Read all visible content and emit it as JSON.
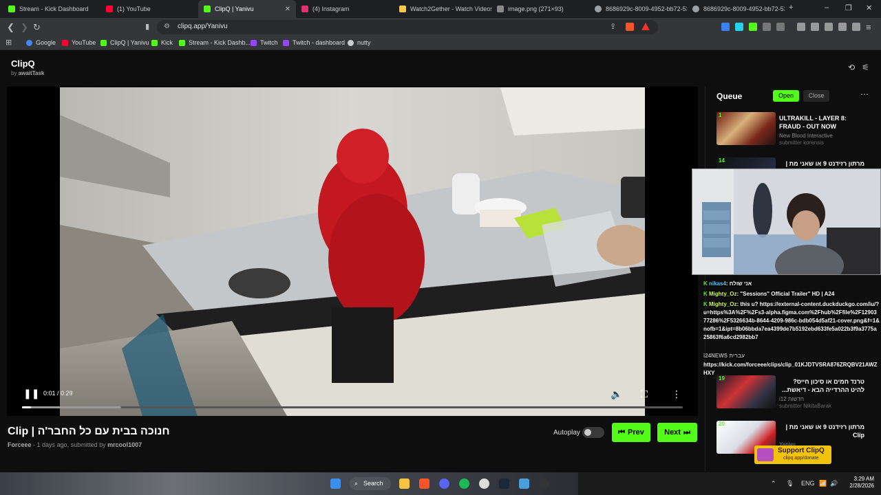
{
  "browser": {
    "tabs": [
      {
        "title": "Stream - Kick Dashboard",
        "color": "#53fc18"
      },
      {
        "title": "(1) YouTube",
        "color": "#ff0033"
      },
      {
        "title": "ClipQ | Yanivu",
        "color": "#53fc18",
        "active": true
      },
      {
        "title": "(4) Instagram",
        "color": "#e1306c"
      },
      {
        "title": "Watch2Gether - Watch Videos",
        "color": "#f2c94c"
      },
      {
        "title": "image.png (271×93)",
        "color": "#888888"
      },
      {
        "title": "8686929c-8009-4952-bb72-53",
        "color": "#9aa0a6"
      },
      {
        "title": "8686929c-8009-4952-bb72-53",
        "color": "#9aa0a6"
      }
    ],
    "url": "clipq.app/Yanivu",
    "bookmarks": [
      {
        "label": "Google",
        "color": "#4285f4"
      },
      {
        "label": "YouTube",
        "color": "#ff0033"
      },
      {
        "label": "ClipQ | Yanivu",
        "color": "#53fc18"
      },
      {
        "label": "Kick",
        "color": "#53fc18"
      },
      {
        "label": "Stream - Kick Dashb...",
        "color": "#53fc18"
      },
      {
        "label": "Twitch",
        "color": "#9146ff"
      },
      {
        "label": "Twitch - dashboard",
        "color": "#9146ff"
      },
      {
        "label": "nutty",
        "color": "#cccccc"
      }
    ]
  },
  "app": {
    "title": "ClipQ",
    "subtitle_prefix": "by",
    "subtitle_author": "awaitTask"
  },
  "player": {
    "timecode": "0:01 / 0:29",
    "progress_fraction": 0.014,
    "buffered_fraction": 0.15,
    "state": "playing"
  },
  "clip": {
    "title": "חנוכה בבית עם כל החבר'ה | Clip",
    "channel": "Forceee",
    "meta_middle": " - 1 days ago, submitted by ",
    "submitter": "mrcool1007"
  },
  "controls": {
    "autoplay_label": "Autoplay",
    "autoplay_on": false,
    "prev_label": "Prev",
    "next_label": "Next"
  },
  "queue": {
    "title": "Queue",
    "open_label": "Open",
    "close_label": "Close",
    "items": [
      {
        "num": "1",
        "title": "ULTRAKILL - LAYER 8: FRAUD - OUT NOW",
        "channel": "New Blood Interactive",
        "submitter": "submitter korensis"
      },
      {
        "num": "14",
        "title": "מרתון רזידנט 9 או שאני מת |",
        "channel": "",
        "submitter": ""
      },
      {
        "num": "19",
        "title": "טרנד חמים או סיכון חייס? להיט ההרדייה הבא - דיאשת...",
        "channel": "i12 חדשות",
        "submitter": "submitter NikitaBarak"
      },
      {
        "num": "20",
        "title": "מרתון רזידנט 9 או שאני מת | Clip",
        "channel": "Yanivu",
        "submitter": ""
      }
    ]
  },
  "chat": {
    "lines": [
      {
        "user": "nikas4",
        "text": "אני שולח"
      },
      {
        "user": "Mighty_Oz",
        "text": "\"Sessions\" Official Trailer\" HD | A24"
      },
      {
        "user": "Mighty_Oz",
        "text": "this u? https://external-content.duckduckgo.com/iu/?u=https%3A%2F%2Fs3-alpha.figma.com%2Fhub%2Ffile%2F1290377286%2F5326634b-8644-4209-986c-bdb054d5af21-cover.png&f=1&nofb=1&ipt=8b06bbda7ea4399de7b5192ebd633fe5a022b3f9a3775a25863f6a6cd2982bb7"
      },
      {
        "user": "",
        "text": "i24NEWS עברית"
      },
      {
        "user": "",
        "text": "https://kick.com/forceee/clips/clip_01KJDTVSRA876ZRQBV21AWZHXY"
      }
    ]
  },
  "support": {
    "label": "Support ClipQ",
    "sub": "clipq.app/donate"
  },
  "taskbar": {
    "search_label": "Search",
    "lang": "ENG",
    "time": "3:29 AM",
    "date": "2/28/2026"
  },
  "colors": {
    "accent": "#53fc18",
    "support": "#f3c20a"
  }
}
